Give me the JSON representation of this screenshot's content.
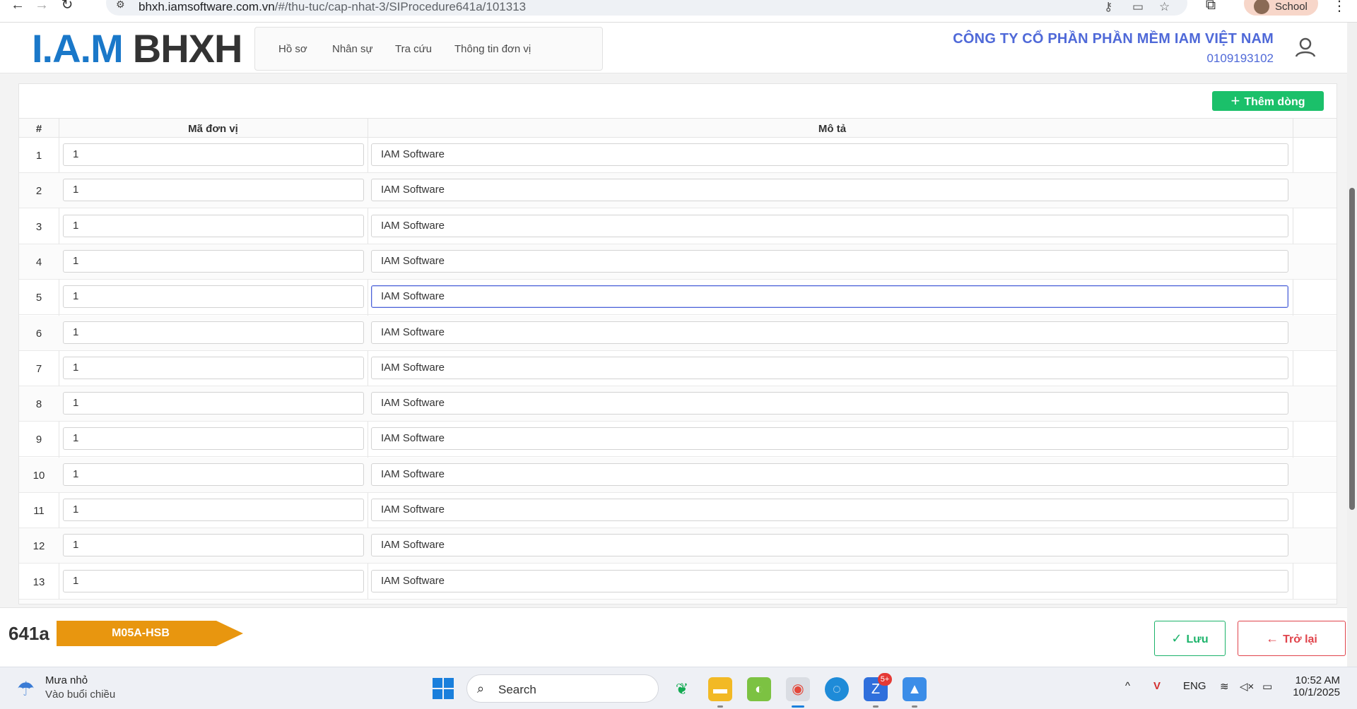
{
  "browser": {
    "url_host": "bhxh.iamsoftware.com.vn",
    "url_path": "/#/thu-tuc/cap-nhat-3/SIProcedure641a/101313",
    "profile_label": "School"
  },
  "header": {
    "logo_iam": "I.A.M",
    "logo_bhxh": "BHXH",
    "nav": [
      "Hồ sơ",
      "Nhân sự",
      "Tra cứu",
      "Thông tin đơn vị"
    ],
    "company_name": "CÔNG TY CỔ PHẦN PHẦN MỀM IAM VIỆT NAM",
    "tax_code": "0109193102"
  },
  "table": {
    "add_button_label": "Thêm dòng",
    "columns": [
      "#",
      "Mã đơn vị",
      "Mô tả"
    ],
    "rows": [
      {
        "index": "1",
        "ma_don_vi": "1",
        "mo_ta": "IAM Software"
      },
      {
        "index": "2",
        "ma_don_vi": "1",
        "mo_ta": "IAM Software"
      },
      {
        "index": "3",
        "ma_don_vi": "1",
        "mo_ta": "IAM Software"
      },
      {
        "index": "4",
        "ma_don_vi": "1",
        "mo_ta": "IAM Software"
      },
      {
        "index": "5",
        "ma_don_vi": "1",
        "mo_ta": "IAM Software"
      },
      {
        "index": "6",
        "ma_don_vi": "1",
        "mo_ta": "IAM Software"
      },
      {
        "index": "7",
        "ma_don_vi": "1",
        "mo_ta": "IAM Software"
      },
      {
        "index": "8",
        "ma_don_vi": "1",
        "mo_ta": "IAM Software"
      },
      {
        "index": "9",
        "ma_don_vi": "1",
        "mo_ta": "IAM Software"
      },
      {
        "index": "10",
        "ma_don_vi": "1",
        "mo_ta": "IAM Software"
      },
      {
        "index": "11",
        "ma_don_vi": "1",
        "mo_ta": "IAM Software"
      },
      {
        "index": "12",
        "ma_don_vi": "1",
        "mo_ta": "IAM Software"
      },
      {
        "index": "13",
        "ma_don_vi": "1",
        "mo_ta": "IAM Software"
      }
    ]
  },
  "footer": {
    "form_code": "641a",
    "form_tag": "M05A-HSB",
    "save_label": "Lưu",
    "back_label": "Trở lại"
  },
  "taskbar": {
    "weather_title": "Mưa nhỏ",
    "weather_sub": "Vào buổi chiều",
    "search_label": "Search",
    "zalo_badge": "5+",
    "lang": "ENG",
    "time": "10:52 AM",
    "date": "10/1/2025"
  },
  "colors": {
    "brand_blue": "#1a78c9",
    "company_blue": "#4f69d8",
    "add_green": "#1bc06a",
    "save_green": "#1bb36a",
    "back_red": "#e0434b",
    "tag_orange": "#e8960f",
    "focus_border": "#4d62d8"
  }
}
